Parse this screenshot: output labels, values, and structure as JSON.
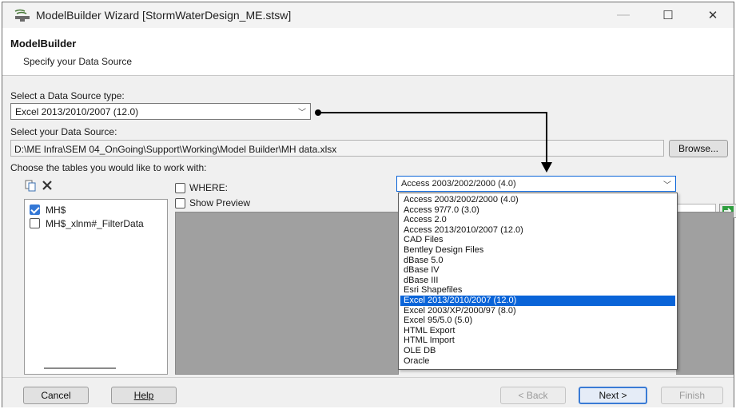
{
  "window": {
    "title": "ModelBuilder Wizard [StormWaterDesign_ME.stsw]",
    "minimize": "—",
    "maximize": "☐",
    "close": "✕"
  },
  "header": {
    "title": "ModelBuilder",
    "subtitle": "Specify your Data Source"
  },
  "source_type": {
    "label": "Select a Data Source type:",
    "value": "Excel 2013/2010/2007 (12.0)"
  },
  "data_source": {
    "label": "Select your Data Source:",
    "value": "D:\\ME Infra\\SEM 04_OnGoing\\Support\\Working\\Model Builder\\MH data.xlsx",
    "browse_label": "Browse..."
  },
  "tables": {
    "label": "Choose the tables you would like to work with:",
    "items": [
      {
        "label": "MH$",
        "checked": true
      },
      {
        "label": "MH$_xlnm#_FilterData",
        "checked": false
      }
    ]
  },
  "where_label": "WHERE:",
  "show_preview_label": "Show Preview",
  "dropdown": {
    "current": "Access 2003/2002/2000 (4.0)",
    "options": [
      "Access 2003/2002/2000 (4.0)",
      "Access 97/7.0 (3.0)",
      "Access 2.0",
      "Access 2013/2010/2007 (12.0)",
      "CAD Files",
      "Bentley Design Files",
      "dBase 5.0",
      "dBase IV",
      "dBase III",
      "Esri Shapefiles",
      "Excel 2013/2010/2007 (12.0)",
      "Excel 2003/XP/2000/97 (8.0)",
      "Excel 95/5.0 (5.0)",
      "HTML Export",
      "HTML Import",
      "OLE DB",
      "Oracle"
    ],
    "selected_index": 10
  },
  "footer": {
    "cancel": "Cancel",
    "help": "Help",
    "back": "< Back",
    "next": "Next >",
    "finish": "Finish"
  },
  "colors": {
    "accent": "#0a64d8",
    "preview_bg": "#a0a0a0",
    "go_arrow": "#2e9e3e"
  },
  "icons": [
    "app-icon",
    "copy-icon",
    "delete-icon",
    "go-arrow-icon",
    "dropdown-chevron-icon"
  ]
}
